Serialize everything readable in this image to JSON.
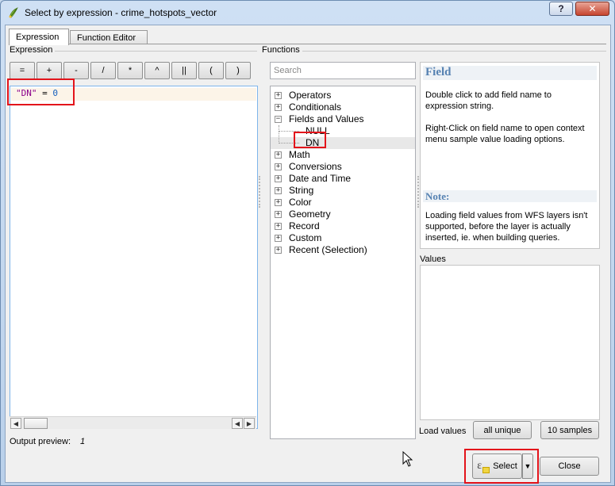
{
  "window": {
    "title": "Select by expression - crime_hotspots_vector",
    "help_button": "?",
    "close_button": "✕"
  },
  "tabs": [
    {
      "label": "Expression",
      "active": true
    },
    {
      "label": "Function Editor",
      "active": false
    }
  ],
  "expression": {
    "section_label": "Expression",
    "operators": [
      "=",
      "+",
      "-",
      "/",
      "*",
      "^",
      "||",
      "(",
      ")"
    ],
    "editor": {
      "field_token": "\"DN\"",
      "operator_token": "=",
      "value_token": "0"
    },
    "output_preview_label": "Output preview:",
    "output_preview_value": "1"
  },
  "functions": {
    "section_label": "Functions",
    "search_placeholder": "Search",
    "tree": [
      {
        "label": "Operators",
        "expanded": false
      },
      {
        "label": "Conditionals",
        "expanded": false
      },
      {
        "label": "Fields and Values",
        "expanded": true
      },
      {
        "label": "NULL",
        "child": true
      },
      {
        "label": "DN",
        "child": true,
        "selected": true
      },
      {
        "label": "Math",
        "expanded": false
      },
      {
        "label": "Conversions",
        "expanded": false
      },
      {
        "label": "Date and Time",
        "expanded": false
      },
      {
        "label": "String",
        "expanded": false
      },
      {
        "label": "Color",
        "expanded": false
      },
      {
        "label": "Geometry",
        "expanded": false
      },
      {
        "label": "Record",
        "expanded": false
      },
      {
        "label": "Custom",
        "expanded": false
      },
      {
        "label": "Recent (Selection)",
        "expanded": false
      }
    ]
  },
  "help": {
    "title": "Field",
    "paragraph1": "Double click to add field name to expression string.",
    "paragraph2": "Right-Click on field name to open context menu sample value loading options.",
    "note_title": "Note:",
    "note_text": "Loading field values from WFS layers isn't supported, before the layer is actually inserted, ie. when building queries."
  },
  "values": {
    "label": "Values",
    "load_label": "Load values",
    "all_unique_label": "all unique",
    "samples_label": "10 samples"
  },
  "footer": {
    "select_label": "Select",
    "close_label": "Close"
  },
  "icons": {
    "app": "qgis-icon",
    "select": "expression-epsilon-icon",
    "dropdown": "caret-down-icon"
  },
  "colors": {
    "highlight_box": "#e3141b",
    "field_token": "#8b008b",
    "number_token": "#1760bd",
    "help_heading": "#5682b2"
  }
}
